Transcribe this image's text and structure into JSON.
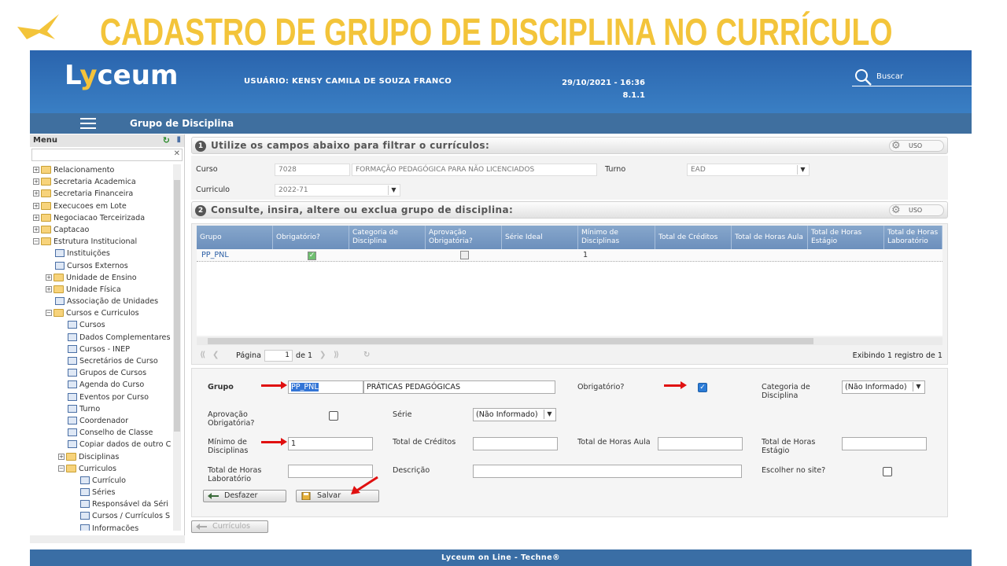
{
  "slide": {
    "title": "CADASTRO DE GRUPO DE DISCIPLINA NO CURRÍCULO"
  },
  "header": {
    "logo": "Lyceum",
    "user_label": "USUÁRIO:",
    "user_name": "KENSY CAMILA DE SOUZA FRANCO",
    "datetime": "29/10/2021 - 16:36",
    "version": "8.1.1",
    "search_label": "Buscar"
  },
  "nav": {
    "title": "Grupo de Disciplina"
  },
  "sidebar": {
    "title": "Menu",
    "items": [
      {
        "label": "Relacionamento",
        "type": "folder",
        "level": 0,
        "expanded": false
      },
      {
        "label": "Secretaria Academica",
        "type": "folder",
        "level": 0,
        "expanded": false
      },
      {
        "label": "Secretaria Financeira",
        "type": "folder",
        "level": 0,
        "expanded": false
      },
      {
        "label": "Execucoes em Lote",
        "type": "folder",
        "level": 0,
        "expanded": false
      },
      {
        "label": "Negociacao Terceirizada",
        "type": "folder",
        "level": 0,
        "expanded": false
      },
      {
        "label": "Captacao",
        "type": "folder",
        "level": 0,
        "expanded": false
      },
      {
        "label": "Estrutura Institucional",
        "type": "folder",
        "level": 0,
        "expanded": true
      },
      {
        "label": "Instituições",
        "type": "page",
        "level": 1
      },
      {
        "label": "Cursos Externos",
        "type": "page",
        "level": 1
      },
      {
        "label": "Unidade de Ensino",
        "type": "folder",
        "level": 1,
        "expanded": false
      },
      {
        "label": "Unidade Física",
        "type": "folder",
        "level": 1,
        "expanded": false
      },
      {
        "label": "Associação de Unidades",
        "type": "page",
        "level": 1
      },
      {
        "label": "Cursos e Curriculos",
        "type": "folder",
        "level": 1,
        "expanded": true
      },
      {
        "label": "Cursos",
        "type": "page",
        "level": 2
      },
      {
        "label": "Dados Complementares",
        "type": "page",
        "level": 2
      },
      {
        "label": "Cursos - INEP",
        "type": "page",
        "level": 2
      },
      {
        "label": "Secretários de Curso",
        "type": "page",
        "level": 2
      },
      {
        "label": "Grupos de Cursos",
        "type": "page",
        "level": 2
      },
      {
        "label": "Agenda do Curso",
        "type": "page",
        "level": 2
      },
      {
        "label": "Eventos por Curso",
        "type": "page",
        "level": 2
      },
      {
        "label": "Turno",
        "type": "page",
        "level": 2
      },
      {
        "label": "Coordenador",
        "type": "page",
        "level": 2
      },
      {
        "label": "Conselho de Classe",
        "type": "page",
        "level": 2
      },
      {
        "label": "Copiar dados de outro C",
        "type": "page",
        "level": 2
      },
      {
        "label": "Disciplinas",
        "type": "folder",
        "level": 2,
        "expanded": false
      },
      {
        "label": "Curriculos",
        "type": "folder",
        "level": 2,
        "expanded": true
      },
      {
        "label": "Currículo",
        "type": "page",
        "level": 3
      },
      {
        "label": "Séries",
        "type": "page",
        "level": 3
      },
      {
        "label": "Responsável da Séri",
        "type": "page",
        "level": 3
      },
      {
        "label": "Cursos / Currículos S",
        "type": "page",
        "level": 3
      },
      {
        "label": "Informações",
        "type": "page",
        "level": 3
      }
    ]
  },
  "section1": {
    "num": "1",
    "title": "Utilize os campos abaixo para filtrar o currículos:",
    "uso": "USO"
  },
  "filter": {
    "curso_label": "Curso",
    "curso_code": "7028",
    "curso_name": "FORMAÇÃO PEDAGÓGICA PARA NÃO LICENCIADOS",
    "turno_label": "Turno",
    "turno_value": "EAD",
    "curriculo_label": "Curriculo",
    "curriculo_value": "2022-71"
  },
  "section2": {
    "num": "2",
    "title": "Consulte, insira, altere ou exclua grupo de disciplina:",
    "uso": "USO"
  },
  "grid": {
    "headers": [
      "Grupo",
      "Obrigatório?",
      "Categoria de Disciplina",
      "Aprovação Obrigatória?",
      "Série Ideal",
      "Mínimo de Disciplinas",
      "Total de Créditos",
      "Total de Horas Aula",
      "Total de Horas Estágio",
      "Total de Horas Laboratório"
    ],
    "rows": [
      {
        "grupo": "PP_PNL",
        "obrigatorio": true,
        "categoria": "",
        "aprovacao": false,
        "serie": "",
        "minimo": "1",
        "creditos": "",
        "horas_aula": "",
        "horas_estagio": "",
        "horas_lab": ""
      }
    ]
  },
  "pager": {
    "page_label": "Página",
    "page_value": "1",
    "of_label": "de 1",
    "summary": "Exibindo 1 registro de 1"
  },
  "form": {
    "grupo_label": "Grupo",
    "grupo_code": "PP_PNL",
    "grupo_name": "PRÁTICAS PEDAGÓGICAS",
    "obrigatorio_label": "Obrigatório?",
    "categoria_label": "Categoria de Disciplina",
    "categoria_value": "(Não Informado)",
    "aprovacao_label": "Aprovação Obrigatória?",
    "serie_label": "Série",
    "serie_value": "(Não Informado)",
    "minimo_label": "Mínimo de Disciplinas",
    "minimo_value": "1",
    "creditos_label": "Total de Créditos",
    "horas_aula_label": "Total de Horas Aula",
    "horas_estagio_label": "Total de Horas Estágio",
    "horas_lab_label": "Total de Horas Laboratório",
    "descricao_label": "Descrição",
    "site_label": "Escolher no site?",
    "desfazer": "Desfazer",
    "salvar": "Salvar"
  },
  "back_button": "Currículos",
  "footer": "Lyceum on Line - Techne®",
  "colors": {
    "accent": "#f3c43a",
    "header": "#2a64ad",
    "nav": "#3f6f9f",
    "arrow": "#e01010"
  }
}
